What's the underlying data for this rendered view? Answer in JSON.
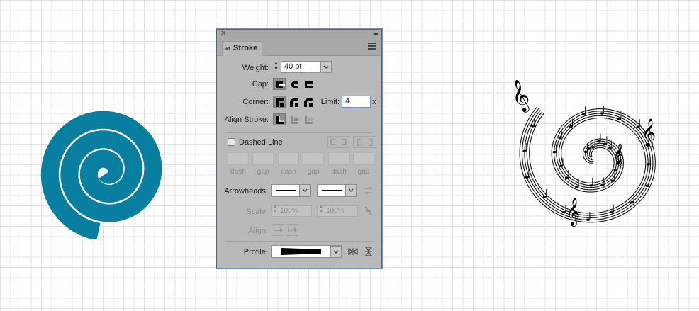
{
  "colors": {
    "spiral": "#087fa0",
    "panel_bg": "#b9b9b9",
    "panel_border": "#3e6a9b",
    "music": "#111111"
  },
  "panel": {
    "close_icon": "close-icon",
    "collapse_icon": "double-chevron-icon",
    "tab_label": "Stroke",
    "menu_icon": "hamburger-menu-icon",
    "weight": {
      "label": "Weight:",
      "value": "40 pt"
    },
    "cap": {
      "label": "Cap:"
    },
    "corner": {
      "label": "Corner:",
      "limit_label": "Limit:",
      "limit_value": "4",
      "limit_suffix": "x"
    },
    "align_stroke": {
      "label": "Align Stroke:"
    },
    "dashed_line": {
      "label": "Dashed Line",
      "checked": false
    },
    "dash_labels": [
      "dash",
      "gap",
      "dash",
      "gap",
      "dash",
      "gap"
    ],
    "arrowheads": {
      "label": "Arrowheads:"
    },
    "scale": {
      "label": "Scale:",
      "start": "100%",
      "end": "100%"
    },
    "align": {
      "label": "Align:"
    },
    "profile": {
      "label": "Profile:"
    }
  }
}
